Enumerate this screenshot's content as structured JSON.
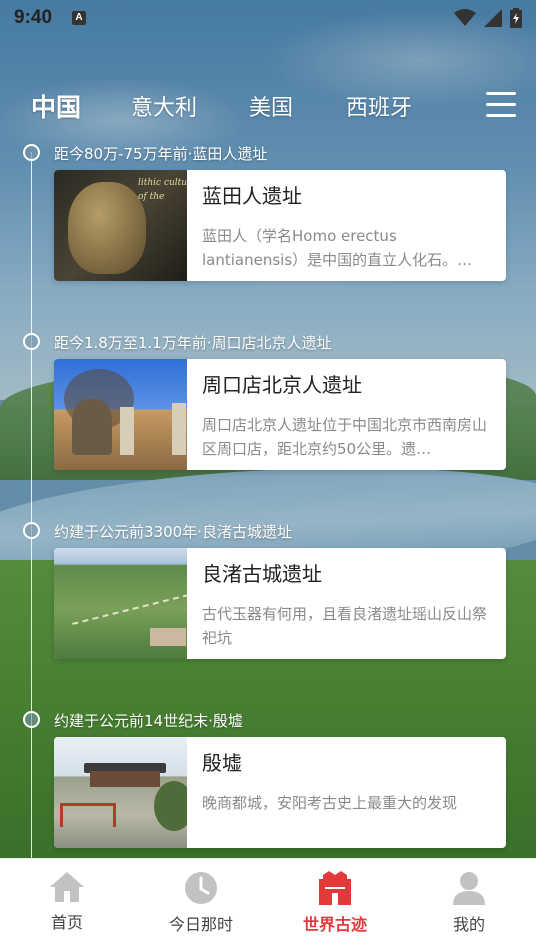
{
  "status_bar": {
    "time": "9:40",
    "notification_icon": "A"
  },
  "top_tabs": [
    {
      "label": "中国",
      "active": true
    },
    {
      "label": "意大利",
      "active": false
    },
    {
      "label": "美国",
      "active": false
    },
    {
      "label": "西班牙",
      "active": false
    }
  ],
  "timeline": [
    {
      "date": "距今80万-75万年前·蓝田人遗址",
      "title": "蓝田人遗址",
      "description": "蓝田人（学名Homo erectus lantianensis）是中国的直立人化石。…",
      "thumb_text": "lithic cultu\nof the"
    },
    {
      "date": "距今1.8万至1.1万年前·周口店北京人遗址",
      "title": "周口店北京人遗址",
      "description": "周口店北京人遗址位于中国北京市西南房山区周口店，距北京约50公里。遗…"
    },
    {
      "date": "约建于公元前3300年·良渚古城遗址",
      "title": "良渚古城遗址",
      "description": "古代玉器有何用，且看良渚遗址瑶山反山祭祀坑"
    },
    {
      "date": "约建于公元前14世纪末·殷墟",
      "title": "殷墟",
      "description": "晚商都城，安阳考古史上最重大的发现"
    }
  ],
  "bottom_nav": [
    {
      "label": "首页",
      "icon": "home-icon",
      "active": false
    },
    {
      "label": "今日那时",
      "icon": "clock-icon",
      "active": false
    },
    {
      "label": "世界古迹",
      "icon": "castle-icon",
      "active": true
    },
    {
      "label": "我的",
      "icon": "person-icon",
      "active": false
    }
  ],
  "colors": {
    "accent": "#e23a3a",
    "nav_inactive_icon": "#c2c2c2",
    "card_desc": "#8a8a8a"
  }
}
